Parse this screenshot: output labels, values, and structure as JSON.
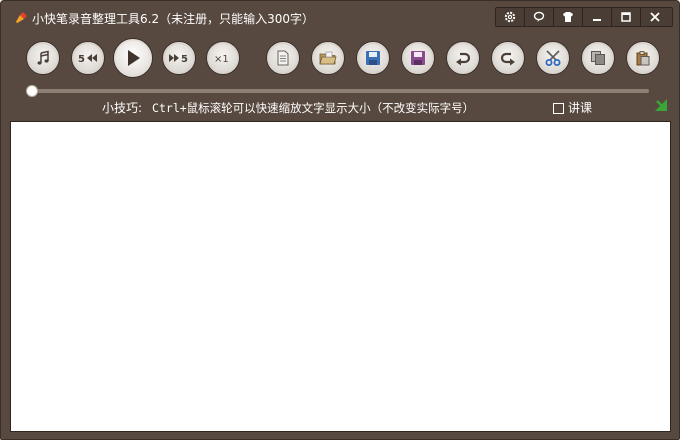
{
  "window": {
    "title": "小快笔录音整理工具6.2（未注册，只能输入300字）",
    "controls": [
      "settings-icon",
      "feedback-icon",
      "skin-icon",
      "minimize-icon",
      "maximize-icon",
      "close-icon"
    ]
  },
  "toolbar": {
    "playback": [
      {
        "name": "music-button",
        "icon": "music-note-icon"
      },
      {
        "name": "rewind-5s-button",
        "label": "5",
        "icon": "rewind-icon"
      },
      {
        "name": "play-button",
        "icon": "play-icon"
      },
      {
        "name": "forward-5s-button",
        "label": "5",
        "icon": "fast-forward-icon"
      },
      {
        "name": "speed-button",
        "label": "×1"
      }
    ],
    "editing": [
      {
        "name": "new-document-button",
        "icon": "document-icon"
      },
      {
        "name": "open-folder-button",
        "icon": "folder-icon"
      },
      {
        "name": "save-button",
        "icon": "floppy-blue-icon"
      },
      {
        "name": "save-as-button",
        "icon": "floppy-purple-icon"
      },
      {
        "name": "undo-button",
        "icon": "undo-icon"
      },
      {
        "name": "redo-button",
        "icon": "redo-icon"
      },
      {
        "name": "cut-button",
        "icon": "scissors-icon"
      },
      {
        "name": "copy-button",
        "icon": "copy-icon"
      },
      {
        "name": "paste-button",
        "icon": "paste-icon"
      }
    ]
  },
  "progress": {
    "value": 0
  },
  "tip": {
    "label": "小技巧:",
    "text": "Ctrl+鼠标滚轮可以快速缩放文字显示大小（不改变实际字号）"
  },
  "lecture": {
    "label": "讲课",
    "checked": false
  },
  "editor": {
    "content": ""
  },
  "colors": {
    "chrome": "#57493f",
    "editor": "#ffffff",
    "accent_green": "#3aa63a"
  }
}
